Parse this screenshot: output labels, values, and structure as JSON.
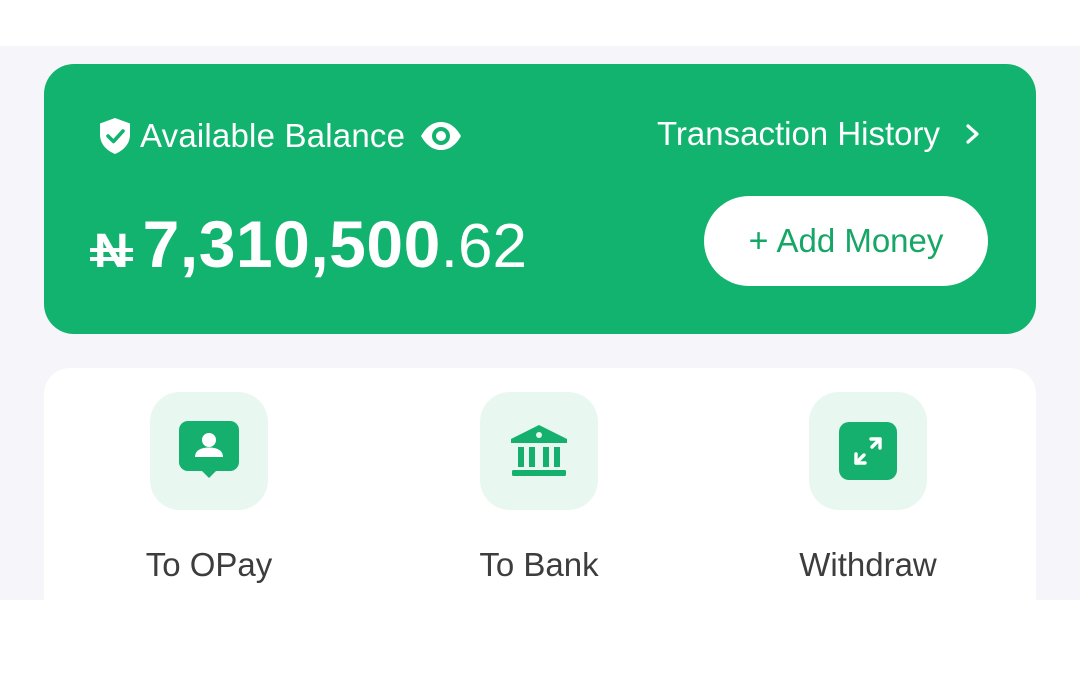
{
  "colors": {
    "brand_green": "#12b36f",
    "tile_green": "#e8f7ef",
    "page_background": "#f5f5fa"
  },
  "balance": {
    "label": "Available Balance",
    "currency_symbol": "N",
    "amount_main": "7,310,500",
    "amount_decimal": ".62",
    "history_label": "Transaction History",
    "add_money_plus": "+",
    "add_money_label": "Add Money"
  },
  "icons": {
    "balance": "shield-check-icon",
    "visibility": "eye-icon",
    "history": "chevron-right-icon",
    "to_opay": "user-chat-icon",
    "to_bank": "bank-icon",
    "withdraw": "expand-arrows-icon"
  },
  "actions": [
    {
      "label": "To OPay"
    },
    {
      "label": "To Bank"
    },
    {
      "label": "Withdraw"
    }
  ]
}
